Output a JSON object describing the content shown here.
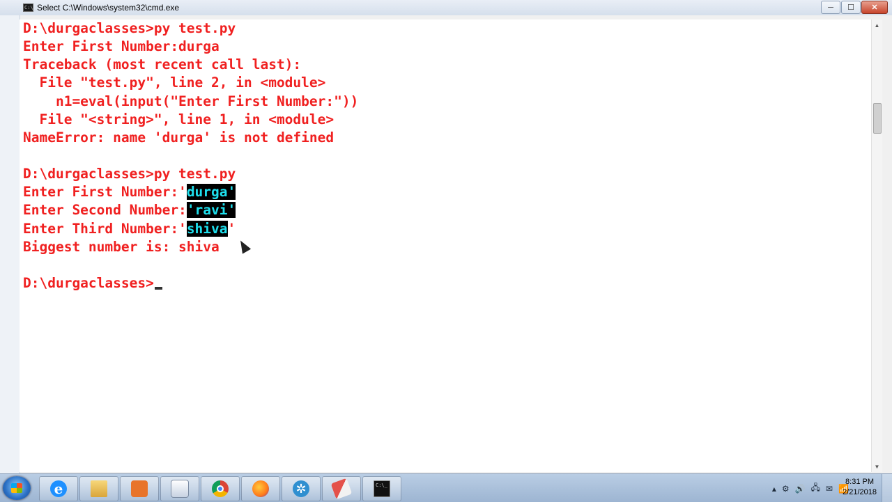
{
  "window": {
    "title": "Select C:\\Windows\\system32\\cmd.exe",
    "icon_label": "C:\\_",
    "minimize_icon": "─",
    "maximize_icon": "☐",
    "close_icon": "✕"
  },
  "console": {
    "text_color": "#f02020",
    "selection_fg": "#1ee0ee",
    "lines": [
      "D:\\durgaclasses>py test.py",
      "Enter First Number:durga",
      "Traceback (most recent call last):",
      "  File \"test.py\", line 2, in <module>",
      "    n1=eval(input(\"Enter First Number:\"))",
      "  File \"<string>\", line 1, in <module>",
      "NameError: name 'durga' is not defined",
      "",
      "D:\\durgaclasses>py test.py"
    ],
    "selected_lines": [
      {
        "prefix": "Enter First Number:'",
        "selected": "durga'",
        "suffix": ""
      },
      {
        "prefix": "Enter Second Number:",
        "selected": "'ravi'",
        "suffix": ""
      },
      {
        "prefix": "Enter Third Number:'",
        "selected": "shiva",
        "suffix": "'"
      }
    ],
    "result_line": "Biggest number is: shiva",
    "prompt": "D:\\durgaclasses>"
  },
  "taskbar": {
    "ie_glyph": "e",
    "settings_glyph": "✲",
    "cmd_label": "C:\\_",
    "clock_time": "8:31 PM",
    "clock_date": "2/21/2018",
    "tray_icons": [
      "▴",
      "⚙",
      "🔊",
      "🖧",
      "✉",
      "📶"
    ]
  }
}
